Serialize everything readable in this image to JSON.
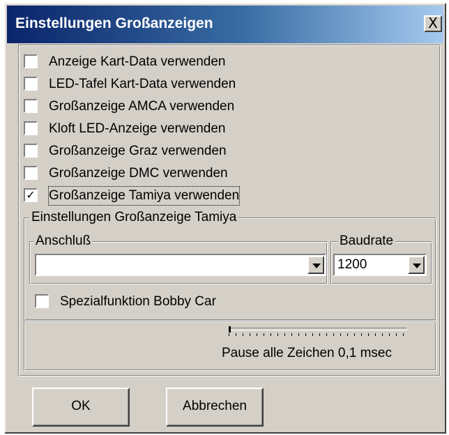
{
  "window": {
    "title": "Einstellungen Großanzeigen",
    "close_label": "X"
  },
  "options": [
    {
      "label": "Anzeige Kart-Data verwenden",
      "checked": false
    },
    {
      "label": "LED-Tafel Kart-Data verwenden",
      "checked": false
    },
    {
      "label": "Großanzeige AMCA verwenden",
      "checked": false
    },
    {
      "label": "Kloft LED-Anzeige verwenden",
      "checked": false
    },
    {
      "label": "Großanzeige Graz verwenden",
      "checked": false
    },
    {
      "label": "Großanzeige DMC verwenden",
      "checked": false
    },
    {
      "label": "Großanzeige Tamiya verwenden",
      "checked": true
    }
  ],
  "tamiya": {
    "group_title": "Einstellungen Großanzeige Tamiya",
    "port_label": "Anschluß",
    "port_value": "",
    "baud_label": "Baudrate",
    "baud_value": "1200",
    "special_label": "Spezialfunktion Bobby Car",
    "special_checked": false,
    "pause_label": "Pause alle Zeichen 0,1 msec",
    "pause_slider_fraction": 0.0
  },
  "buttons": {
    "ok": "OK",
    "cancel": "Abbrechen"
  }
}
